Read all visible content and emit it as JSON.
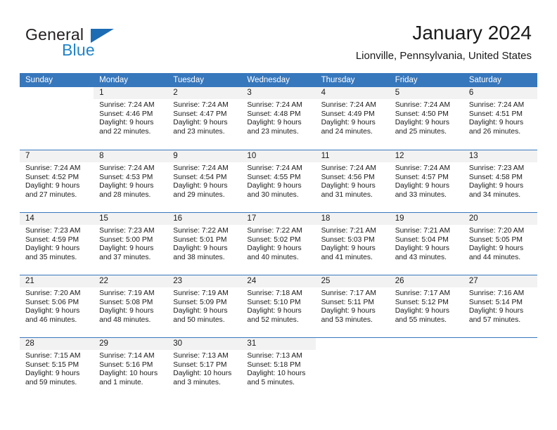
{
  "brand": {
    "name_part1": "General",
    "name_part2": "Blue",
    "triangle_icon": "brand-triangle-icon",
    "color_dark": "#231f20",
    "color_blue": "#2083c8"
  },
  "header": {
    "title": "January 2024",
    "subtitle": "Lionville, Pennsylvania, United States"
  },
  "theme": {
    "header_bar": "#3777bc",
    "day_number_band": "#f2f2f2",
    "text": "#1a1a1a"
  },
  "calendar": {
    "weekdays": [
      "Sunday",
      "Monday",
      "Tuesday",
      "Wednesday",
      "Thursday",
      "Friday",
      "Saturday"
    ],
    "weeks": [
      [
        {
          "day": "",
          "empty": true
        },
        {
          "day": "1",
          "sunrise": "Sunrise: 7:24 AM",
          "sunset": "Sunset: 4:46 PM",
          "daylight_l1": "Daylight: 9 hours",
          "daylight_l2": "and 22 minutes."
        },
        {
          "day": "2",
          "sunrise": "Sunrise: 7:24 AM",
          "sunset": "Sunset: 4:47 PM",
          "daylight_l1": "Daylight: 9 hours",
          "daylight_l2": "and 23 minutes."
        },
        {
          "day": "3",
          "sunrise": "Sunrise: 7:24 AM",
          "sunset": "Sunset: 4:48 PM",
          "daylight_l1": "Daylight: 9 hours",
          "daylight_l2": "and 23 minutes."
        },
        {
          "day": "4",
          "sunrise": "Sunrise: 7:24 AM",
          "sunset": "Sunset: 4:49 PM",
          "daylight_l1": "Daylight: 9 hours",
          "daylight_l2": "and 24 minutes."
        },
        {
          "day": "5",
          "sunrise": "Sunrise: 7:24 AM",
          "sunset": "Sunset: 4:50 PM",
          "daylight_l1": "Daylight: 9 hours",
          "daylight_l2": "and 25 minutes."
        },
        {
          "day": "6",
          "sunrise": "Sunrise: 7:24 AM",
          "sunset": "Sunset: 4:51 PM",
          "daylight_l1": "Daylight: 9 hours",
          "daylight_l2": "and 26 minutes."
        }
      ],
      [
        {
          "day": "7",
          "sunrise": "Sunrise: 7:24 AM",
          "sunset": "Sunset: 4:52 PM",
          "daylight_l1": "Daylight: 9 hours",
          "daylight_l2": "and 27 minutes."
        },
        {
          "day": "8",
          "sunrise": "Sunrise: 7:24 AM",
          "sunset": "Sunset: 4:53 PM",
          "daylight_l1": "Daylight: 9 hours",
          "daylight_l2": "and 28 minutes."
        },
        {
          "day": "9",
          "sunrise": "Sunrise: 7:24 AM",
          "sunset": "Sunset: 4:54 PM",
          "daylight_l1": "Daylight: 9 hours",
          "daylight_l2": "and 29 minutes."
        },
        {
          "day": "10",
          "sunrise": "Sunrise: 7:24 AM",
          "sunset": "Sunset: 4:55 PM",
          "daylight_l1": "Daylight: 9 hours",
          "daylight_l2": "and 30 minutes."
        },
        {
          "day": "11",
          "sunrise": "Sunrise: 7:24 AM",
          "sunset": "Sunset: 4:56 PM",
          "daylight_l1": "Daylight: 9 hours",
          "daylight_l2": "and 31 minutes."
        },
        {
          "day": "12",
          "sunrise": "Sunrise: 7:24 AM",
          "sunset": "Sunset: 4:57 PM",
          "daylight_l1": "Daylight: 9 hours",
          "daylight_l2": "and 33 minutes."
        },
        {
          "day": "13",
          "sunrise": "Sunrise: 7:23 AM",
          "sunset": "Sunset: 4:58 PM",
          "daylight_l1": "Daylight: 9 hours",
          "daylight_l2": "and 34 minutes."
        }
      ],
      [
        {
          "day": "14",
          "sunrise": "Sunrise: 7:23 AM",
          "sunset": "Sunset: 4:59 PM",
          "daylight_l1": "Daylight: 9 hours",
          "daylight_l2": "and 35 minutes."
        },
        {
          "day": "15",
          "sunrise": "Sunrise: 7:23 AM",
          "sunset": "Sunset: 5:00 PM",
          "daylight_l1": "Daylight: 9 hours",
          "daylight_l2": "and 37 minutes."
        },
        {
          "day": "16",
          "sunrise": "Sunrise: 7:22 AM",
          "sunset": "Sunset: 5:01 PM",
          "daylight_l1": "Daylight: 9 hours",
          "daylight_l2": "and 38 minutes."
        },
        {
          "day": "17",
          "sunrise": "Sunrise: 7:22 AM",
          "sunset": "Sunset: 5:02 PM",
          "daylight_l1": "Daylight: 9 hours",
          "daylight_l2": "and 40 minutes."
        },
        {
          "day": "18",
          "sunrise": "Sunrise: 7:21 AM",
          "sunset": "Sunset: 5:03 PM",
          "daylight_l1": "Daylight: 9 hours",
          "daylight_l2": "and 41 minutes."
        },
        {
          "day": "19",
          "sunrise": "Sunrise: 7:21 AM",
          "sunset": "Sunset: 5:04 PM",
          "daylight_l1": "Daylight: 9 hours",
          "daylight_l2": "and 43 minutes."
        },
        {
          "day": "20",
          "sunrise": "Sunrise: 7:20 AM",
          "sunset": "Sunset: 5:05 PM",
          "daylight_l1": "Daylight: 9 hours",
          "daylight_l2": "and 44 minutes."
        }
      ],
      [
        {
          "day": "21",
          "sunrise": "Sunrise: 7:20 AM",
          "sunset": "Sunset: 5:06 PM",
          "daylight_l1": "Daylight: 9 hours",
          "daylight_l2": "and 46 minutes."
        },
        {
          "day": "22",
          "sunrise": "Sunrise: 7:19 AM",
          "sunset": "Sunset: 5:08 PM",
          "daylight_l1": "Daylight: 9 hours",
          "daylight_l2": "and 48 minutes."
        },
        {
          "day": "23",
          "sunrise": "Sunrise: 7:19 AM",
          "sunset": "Sunset: 5:09 PM",
          "daylight_l1": "Daylight: 9 hours",
          "daylight_l2": "and 50 minutes."
        },
        {
          "day": "24",
          "sunrise": "Sunrise: 7:18 AM",
          "sunset": "Sunset: 5:10 PM",
          "daylight_l1": "Daylight: 9 hours",
          "daylight_l2": "and 52 minutes."
        },
        {
          "day": "25",
          "sunrise": "Sunrise: 7:17 AM",
          "sunset": "Sunset: 5:11 PM",
          "daylight_l1": "Daylight: 9 hours",
          "daylight_l2": "and 53 minutes."
        },
        {
          "day": "26",
          "sunrise": "Sunrise: 7:17 AM",
          "sunset": "Sunset: 5:12 PM",
          "daylight_l1": "Daylight: 9 hours",
          "daylight_l2": "and 55 minutes."
        },
        {
          "day": "27",
          "sunrise": "Sunrise: 7:16 AM",
          "sunset": "Sunset: 5:14 PM",
          "daylight_l1": "Daylight: 9 hours",
          "daylight_l2": "and 57 minutes."
        }
      ],
      [
        {
          "day": "28",
          "sunrise": "Sunrise: 7:15 AM",
          "sunset": "Sunset: 5:15 PM",
          "daylight_l1": "Daylight: 9 hours",
          "daylight_l2": "and 59 minutes."
        },
        {
          "day": "29",
          "sunrise": "Sunrise: 7:14 AM",
          "sunset": "Sunset: 5:16 PM",
          "daylight_l1": "Daylight: 10 hours",
          "daylight_l2": "and 1 minute."
        },
        {
          "day": "30",
          "sunrise": "Sunrise: 7:13 AM",
          "sunset": "Sunset: 5:17 PM",
          "daylight_l1": "Daylight: 10 hours",
          "daylight_l2": "and 3 minutes."
        },
        {
          "day": "31",
          "sunrise": "Sunrise: 7:13 AM",
          "sunset": "Sunset: 5:18 PM",
          "daylight_l1": "Daylight: 10 hours",
          "daylight_l2": "and 5 minutes."
        },
        {
          "day": "",
          "empty": true
        },
        {
          "day": "",
          "empty": true
        },
        {
          "day": "",
          "empty": true
        }
      ]
    ]
  }
}
